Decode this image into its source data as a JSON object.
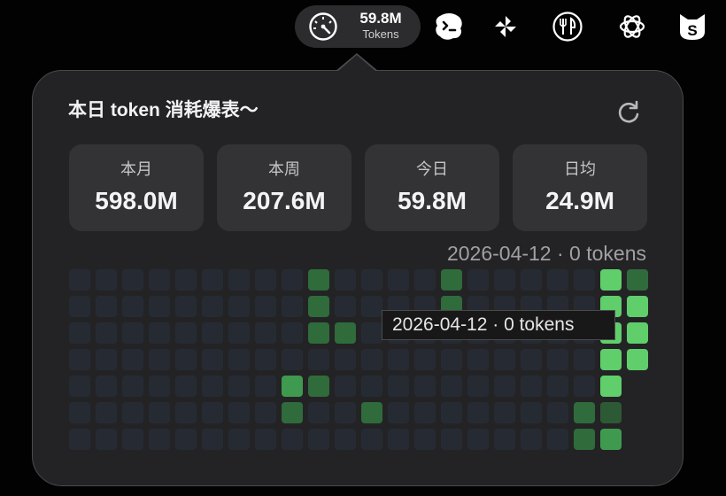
{
  "menubar": {
    "usage_value": "59.8M",
    "usage_unit": "Tokens",
    "icons": [
      "gauge-icon",
      "terminal-face-icon",
      "pinwheel-icon",
      "fork-knife-icon",
      "openai-icon",
      "cat-s-icon"
    ]
  },
  "popover": {
    "title": "本日 token 消耗爆表～",
    "stats": [
      {
        "label": "本月",
        "value": "598.0M"
      },
      {
        "label": "本周",
        "value": "207.6M"
      },
      {
        "label": "今日",
        "value": "59.8M"
      },
      {
        "label": "日均",
        "value": "24.9M"
      }
    ],
    "hover_readout": "2026-04-12 · 0 tokens",
    "tooltip": "2026-04-12 · 0 tokens"
  },
  "heatmap": {
    "rows": 7,
    "cols": 21,
    "levels": [
      [
        0,
        0,
        0,
        0,
        0,
        0,
        0,
        0,
        0,
        2,
        0,
        0,
        0,
        0,
        2,
        0,
        0,
        0,
        0,
        0,
        4,
        2
      ],
      [
        0,
        0,
        0,
        0,
        0,
        0,
        0,
        0,
        0,
        2,
        0,
        0,
        0,
        0,
        2,
        0,
        0,
        0,
        0,
        0,
        4,
        4
      ],
      [
        0,
        0,
        0,
        0,
        0,
        0,
        0,
        0,
        0,
        2,
        2,
        0,
        0,
        0,
        0,
        0,
        0,
        0,
        0,
        0,
        4,
        4
      ],
      [
        0,
        0,
        0,
        0,
        0,
        0,
        0,
        0,
        0,
        0,
        0,
        0,
        0,
        0,
        0,
        0,
        0,
        0,
        0,
        0,
        4,
        4
      ],
      [
        0,
        0,
        0,
        0,
        0,
        0,
        0,
        0,
        3,
        2,
        0,
        0,
        0,
        0,
        0,
        0,
        0,
        0,
        0,
        0,
        4,
        -1
      ],
      [
        0,
        0,
        0,
        0,
        0,
        0,
        0,
        0,
        2,
        0,
        0,
        2,
        0,
        0,
        0,
        0,
        0,
        0,
        0,
        2,
        1,
        -1
      ],
      [
        0,
        0,
        0,
        0,
        0,
        0,
        0,
        0,
        0,
        0,
        0,
        0,
        0,
        0,
        0,
        0,
        0,
        0,
        0,
        2,
        3,
        -1
      ]
    ],
    "colors": [
      "#262b33",
      "#2c5a35",
      "#2f6b3b",
      "#3f9a4f",
      "#5fce6b"
    ]
  }
}
